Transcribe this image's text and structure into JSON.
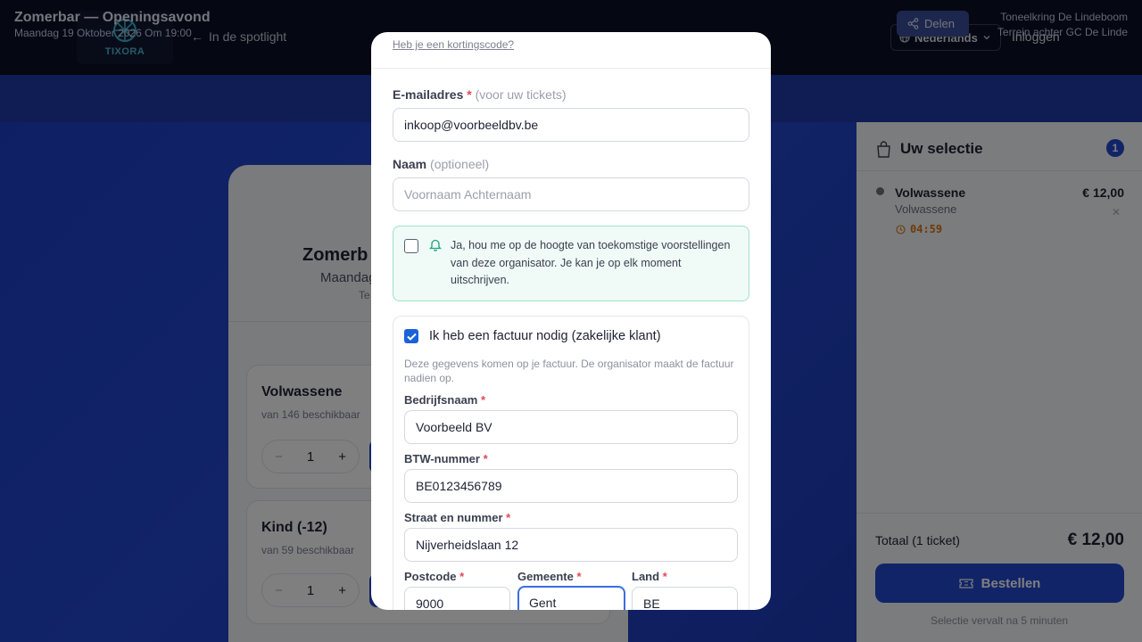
{
  "header": {
    "logo_text": "TIXORA",
    "back_label": "In de spotlight",
    "language": "Nederlands",
    "login": "Inloggen"
  },
  "event": {
    "title": "Zomerbar — Openingsavond",
    "date": "Maandag 19 Oktober 2026 Om 19:00",
    "share": "Delen",
    "organizer": "Toneelkring De Lindeboom",
    "venue": "Terrein achter GC De Linde"
  },
  "card": {
    "title_partial": "Zomerb",
    "date_partial": "Maandag",
    "venue_partial": "Te",
    "tickets": [
      {
        "name": "Volwassene",
        "availability": "van 146 beschikbaar",
        "qty": "1",
        "minus": "−",
        "plus": "+"
      },
      {
        "name": "Kind (-12)",
        "availability": "van 59 beschikbaar",
        "qty": "1",
        "minus": "−",
        "plus": "+"
      }
    ]
  },
  "cart": {
    "title": "Uw selectie",
    "count": "1",
    "item": {
      "name": "Volwassene",
      "sub": "Volwassene",
      "price": "€ 12,00",
      "timer": "04:59",
      "remove": "✕"
    },
    "total_label": "Totaal (1 ticket)",
    "total_value": "€ 12,00",
    "order_button": "Bestellen",
    "expire_note": "Selectie vervalt na 5 minuten"
  },
  "modal": {
    "discount_link": "Heb je een kortingscode?",
    "email": {
      "label": "E-mailadres",
      "required": "*",
      "hint": "(voor uw tickets)",
      "value": "inkoop@voorbeeldbv.be"
    },
    "name": {
      "label": "Naam",
      "hint": "(optioneel)",
      "placeholder": "Voornaam Achternaam"
    },
    "optin_text": "Ja, hou me op de hoogte van toekomstige voorstellingen van deze organisator. Je kan je op elk moment uitschrijven.",
    "optin_checked": false,
    "invoice": {
      "checked": true,
      "label": "Ik heb een factuur nodig (zakelijke klant)",
      "note": "Deze gegevens komen op je factuur. De organisator maakt de factuur nadien op.",
      "company_label": "Bedrijfsnaam",
      "company_value": "Voorbeeld BV",
      "vat_label": "BTW-nummer",
      "vat_value": "BE0123456789",
      "street_label": "Straat en nummer",
      "street_value": "Nijverheidslaan 12",
      "postcode_label": "Postcode",
      "postcode_value": "9000",
      "city_label": "Gemeente",
      "city_value": "Gent",
      "country_label": "Land",
      "country_value": "BE",
      "required": "*"
    }
  }
}
